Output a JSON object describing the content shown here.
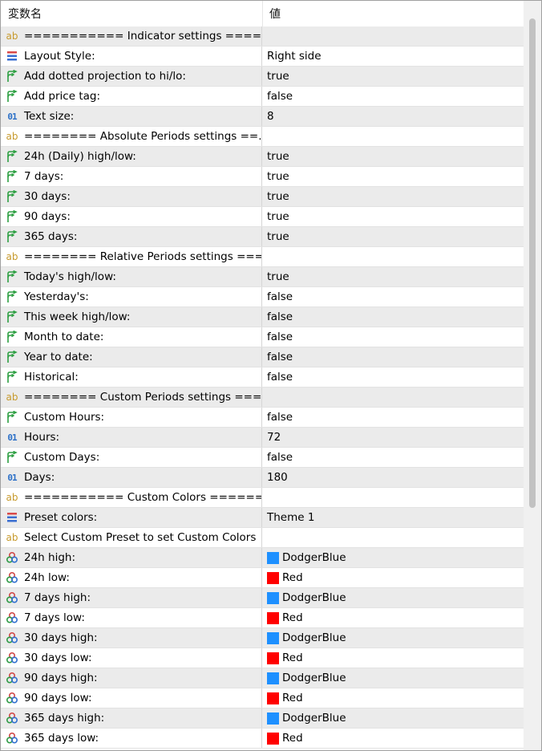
{
  "header": {
    "col1": "変数名",
    "col2": "値"
  },
  "colors": {
    "DodgerBlue": "#1e90ff",
    "Red": "#ff0000"
  },
  "rows": [
    {
      "icon": "string-icon",
      "label": "=========== Indicator settings ====...",
      "value": ""
    },
    {
      "icon": "enum-icon",
      "label": "Layout Style:",
      "value": "Right side"
    },
    {
      "icon": "bool-icon",
      "label": "Add dotted projection to hi/lo:",
      "value": "true"
    },
    {
      "icon": "bool-icon",
      "label": "Add price tag:",
      "value": "false"
    },
    {
      "icon": "int-icon",
      "label": "Text size:",
      "value": "8"
    },
    {
      "icon": "string-icon",
      "label": "======== Absolute Periods settings ==...",
      "value": ""
    },
    {
      "icon": "bool-icon",
      "label": "24h (Daily) high/low:",
      "value": "true"
    },
    {
      "icon": "bool-icon",
      "label": "7 days:",
      "value": "true"
    },
    {
      "icon": "bool-icon",
      "label": "30 days:",
      "value": "true"
    },
    {
      "icon": "bool-icon",
      "label": "90 days:",
      "value": "true"
    },
    {
      "icon": "bool-icon",
      "label": "365 days:",
      "value": "true"
    },
    {
      "icon": "string-icon",
      "label": "======== Relative Periods settings ===...",
      "value": ""
    },
    {
      "icon": "bool-icon",
      "label": "Today's high/low:",
      "value": "true"
    },
    {
      "icon": "bool-icon",
      "label": "Yesterday's:",
      "value": "false"
    },
    {
      "icon": "bool-icon",
      "label": "This week high/low:",
      "value": "false"
    },
    {
      "icon": "bool-icon",
      "label": "Month to date:",
      "value": "false"
    },
    {
      "icon": "bool-icon",
      "label": "Year to date:",
      "value": "false"
    },
    {
      "icon": "bool-icon",
      "label": "Historical:",
      "value": "false"
    },
    {
      "icon": "string-icon",
      "label": "======== Custom Periods settings ===...",
      "value": ""
    },
    {
      "icon": "bool-icon",
      "label": "Custom Hours:",
      "value": "false"
    },
    {
      "icon": "int-icon",
      "label": "Hours:",
      "value": "72"
    },
    {
      "icon": "bool-icon",
      "label": "Custom Days:",
      "value": "false"
    },
    {
      "icon": "int-icon",
      "label": "Days:",
      "value": "180"
    },
    {
      "icon": "string-icon",
      "label": "=========== Custom Colors ======...",
      "value": ""
    },
    {
      "icon": "enum-icon",
      "label": "Preset colors:",
      "value": "Theme 1"
    },
    {
      "icon": "string-icon",
      "label": "Select Custom Preset to set Custom Colors",
      "value": ""
    },
    {
      "icon": "color-icon",
      "label": "24h high:",
      "value": "DodgerBlue",
      "swatch": "#1e90ff"
    },
    {
      "icon": "color-icon",
      "label": "24h low:",
      "value": "Red",
      "swatch": "#ff0000"
    },
    {
      "icon": "color-icon",
      "label": "7 days high:",
      "value": "DodgerBlue",
      "swatch": "#1e90ff"
    },
    {
      "icon": "color-icon",
      "label": "7 days low:",
      "value": "Red",
      "swatch": "#ff0000"
    },
    {
      "icon": "color-icon",
      "label": "30 days high:",
      "value": "DodgerBlue",
      "swatch": "#1e90ff"
    },
    {
      "icon": "color-icon",
      "label": "30 days low:",
      "value": "Red",
      "swatch": "#ff0000"
    },
    {
      "icon": "color-icon",
      "label": "90 days high:",
      "value": "DodgerBlue",
      "swatch": "#1e90ff"
    },
    {
      "icon": "color-icon",
      "label": "90 days low:",
      "value": "Red",
      "swatch": "#ff0000"
    },
    {
      "icon": "color-icon",
      "label": "365 days high:",
      "value": "DodgerBlue",
      "swatch": "#1e90ff"
    },
    {
      "icon": "color-icon",
      "label": "365 days low:",
      "value": "Red",
      "swatch": "#ff0000"
    }
  ]
}
